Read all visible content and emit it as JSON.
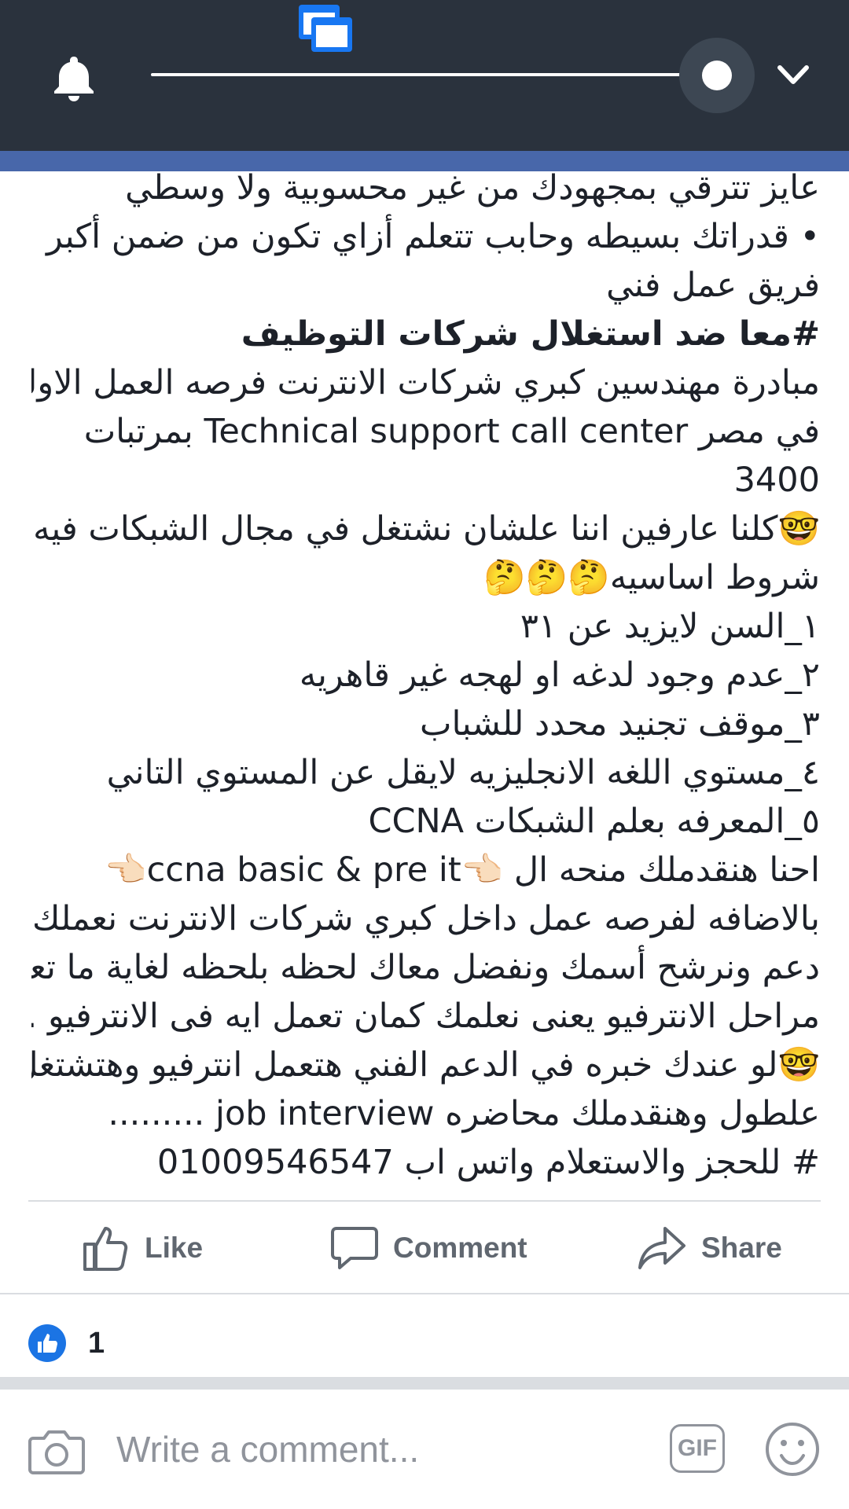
{
  "colors": {
    "top_bar": "#2a323d",
    "accent_strip": "#4867aa",
    "text": "#1d2129",
    "action_text": "#606770",
    "like_blue": "#1b74e4"
  },
  "status_bar": {
    "icons": [
      "notification-bell-icon",
      "brightness-slider",
      "chevron-down-icon",
      "app-window-icon"
    ],
    "brightness_level": 0.92
  },
  "post": {
    "lines": [
      "عايز تترقي بمجهودك من غير محسوبية ولا وسطي",
      "• قدراتك بسيطه وحابب تتعلم أزاي تكون من ضمن أكبر",
      "فريق عمل فني",
      "#معا ضد استغلال شركات التوظيف",
      "مبادرة مهندسين كبري شركات الانترنت فرصه العمل الاولي",
      "في مصر Technical support call center بمرتبات",
      "3400",
      "🤓كلنا عارفين اننا علشان نشتغل في مجال الشبكات فيه",
      "شروط اساسيه🤔🤔🤔",
      "١_السن لايزيد عن ٣١",
      "٢_عدم وجود لدغه او لهجه غير قاهريه",
      "٣_موقف تجنيد محدد للشباب",
      "٤_مستوي اللغه الانجليزيه لايقل عن المستوي التاني",
      "٥_المعرفه بعلم الشبكات CCNA",
      "احنا هنقدملك منحه ال 👈🏻ccna basic & pre it👈🏻",
      "بالاضافه لفرصه عمل داخل كبري شركات الانترنت نعملك",
      "دعم ونرشح أسمك ونفضل معاك لحظه بلحظه لغاية ما تعدي",
      "مراحل الانترفيو يعنى نعلمك كمان تعمل ايه فى الانترفيو .",
      "🤓لو عندك خبره في الدعم الفني هتعمل انترفيو وهتشتغل",
      "علطول وهنقدملك محاضره job interview .........",
      "# للحجز والاستعلام واتس اب 01009546547"
    ]
  },
  "actions": {
    "like": "Like",
    "comment": "Comment",
    "share": "Share"
  },
  "reactions": {
    "icon": "like-thumb-icon",
    "count": "1"
  },
  "composer": {
    "placeholder": "Write a comment...",
    "gif_label": "GIF",
    "camera_icon": "camera-icon",
    "sticker_icon": "smiley-icon"
  }
}
